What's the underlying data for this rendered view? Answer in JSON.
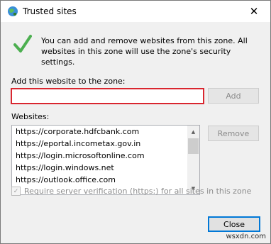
{
  "window": {
    "title": "Trusted sites",
    "close_glyph": "✕"
  },
  "icons": {
    "title_icon": "globe-shield-icon",
    "info_icon": "checkmark-icon"
  },
  "info": {
    "text": "You can add and remove websites from this zone. All websites in this zone will use the zone's security settings."
  },
  "add_site": {
    "label": "Add this website to the zone:",
    "value": "",
    "button_label": "Add"
  },
  "websites": {
    "label": "Websites:",
    "items": [
      "https://corporate.hdfcbank.com",
      "https://eportal.incometax.gov.in",
      "https://login.microsoftonline.com",
      "https://login.windows.net",
      "https://outlook.office.com"
    ],
    "remove_label": "Remove"
  },
  "verification": {
    "label": "Require server verification (https:) for all sites in this zone",
    "checked": true
  },
  "footer": {
    "close_label": "Close"
  },
  "watermark": "wsxdn.com",
  "colors": {
    "input_highlight": "#d9262f",
    "close_border": "#0078d7",
    "check_green": "#4caf50"
  }
}
